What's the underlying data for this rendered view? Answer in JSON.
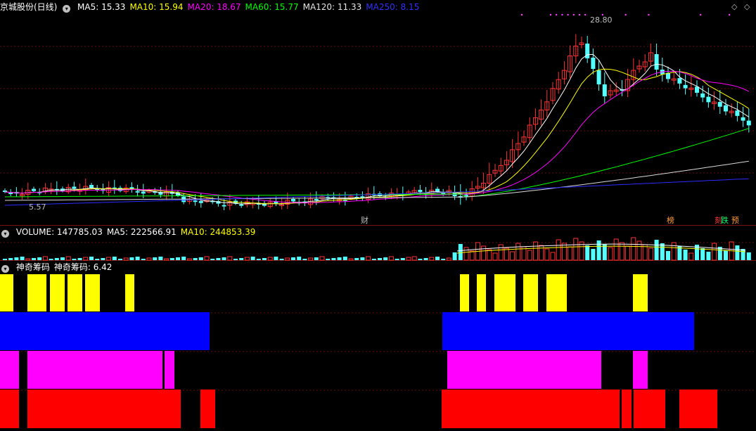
{
  "price_panel": {
    "stock_name": "京城股份(日线)",
    "ma_labels": [
      {
        "text": "MA5: 15.33",
        "color": "#ffffff"
      },
      {
        "text": "MA10: 15.94",
        "color": "#ffff00"
      },
      {
        "text": "MA20: 18.67",
        "color": "#ff00ff"
      },
      {
        "text": "MA60: 15.77",
        "color": "#00ff00"
      },
      {
        "text": "MA120: 11.33",
        "color": "#e6e6e6"
      },
      {
        "text": "MA250: 8.15",
        "color": "#3030ff"
      }
    ],
    "high_label": "28.80",
    "low_label": "5.57",
    "event_tags": [
      {
        "text": "财",
        "color": "#bfbfbf"
      },
      {
        "text": "榜",
        "color": "#ff9933"
      },
      {
        "text": "刻",
        "color": "#ff3333"
      },
      {
        "text": "跌",
        "color": "#00ff66"
      },
      {
        "text": "预",
        "color": "#ff9933"
      }
    ]
  },
  "volume_panel": {
    "labels": [
      {
        "text": "VOLUME: 147785.03",
        "color": "#ffffff"
      },
      {
        "text": "MA5: 222566.91",
        "color": "#ffffff"
      },
      {
        "text": "MA10: 244853.39",
        "color": "#ffff00"
      }
    ]
  },
  "indicator_panel": {
    "labels": [
      {
        "text": "神奇筹码",
        "color": "#ffffff"
      },
      {
        "text": "神奇筹码: 6.42",
        "color": "#ffffff"
      }
    ],
    "band_colors": {
      "yellow": "#ffff00",
      "blue": "#0000ff",
      "magenta": "#ff00ff",
      "red": "#ff0000"
    }
  },
  "controls": {
    "prev_icon": "◇",
    "next_icon": "◇"
  }
}
